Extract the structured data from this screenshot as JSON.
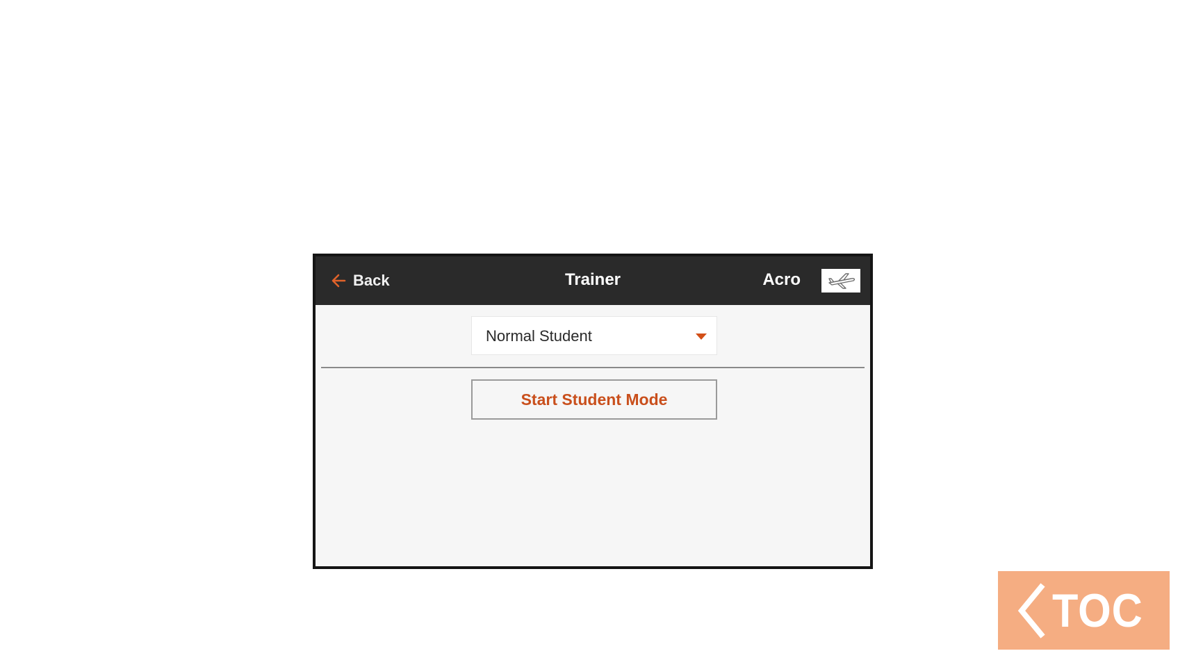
{
  "header": {
    "back_label": "Back",
    "title": "Trainer",
    "model_type": "Acro",
    "model_icon": "airplane-icon",
    "back_icon": "arrow-left-icon"
  },
  "main": {
    "trainer_mode_select": {
      "value": "Normal Student",
      "icon": "chevron-down-icon"
    },
    "start_button_label": "Start Student Mode"
  },
  "toc_button": {
    "label": "TOC",
    "icon": "chevron-left-icon"
  },
  "colors": {
    "accent": "#c94f1c",
    "titlebar": "#2a2a2a",
    "toc_background": "#f5ad82"
  }
}
